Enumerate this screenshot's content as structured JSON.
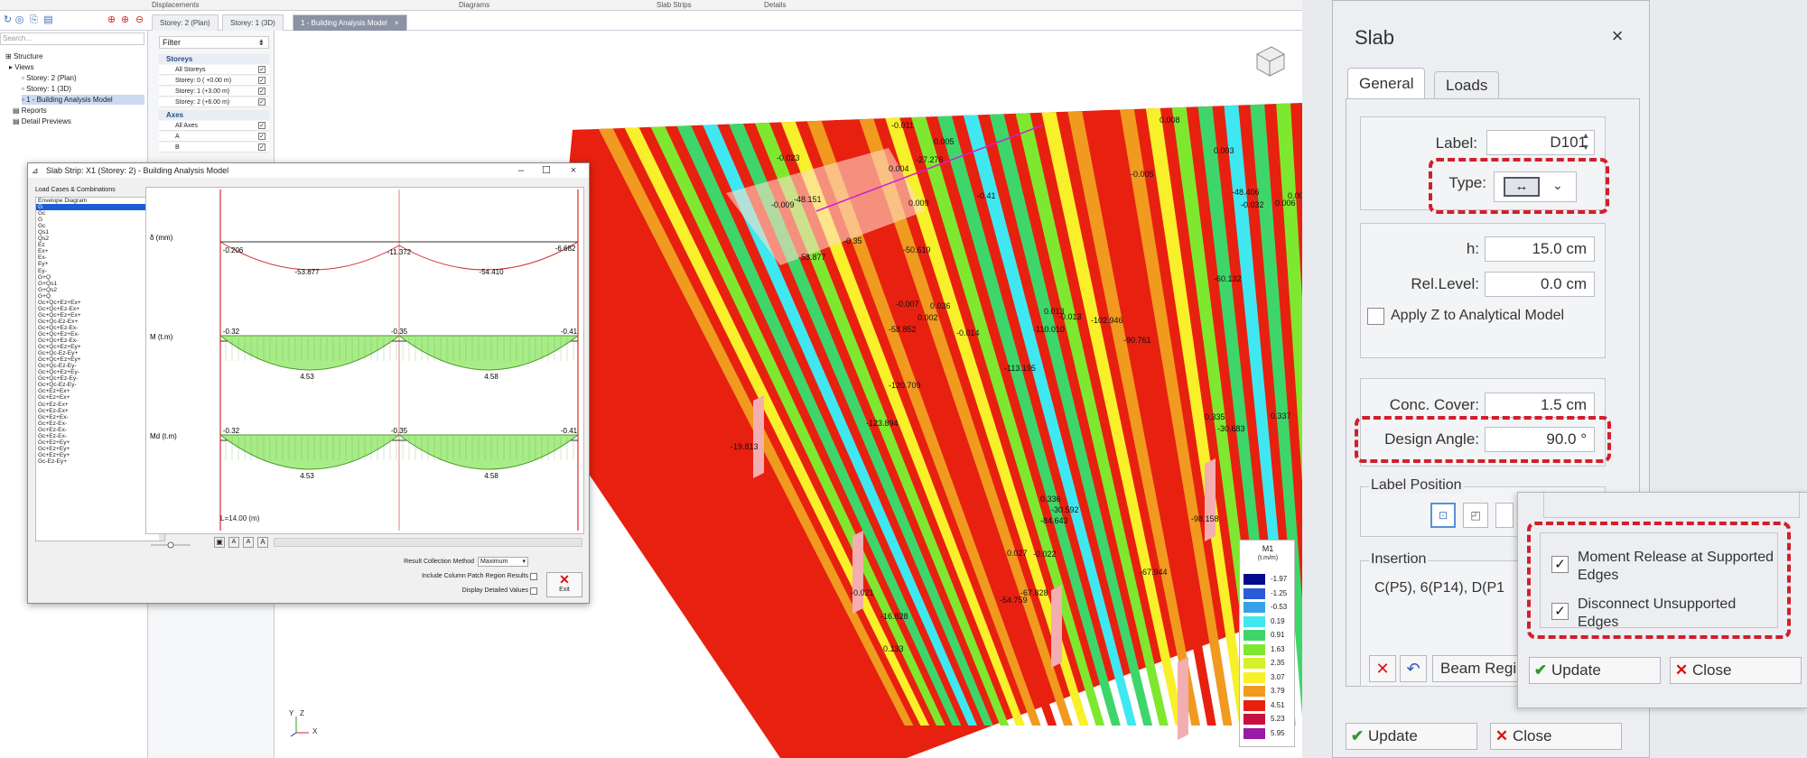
{
  "menubar": {
    "items": [
      "Displacements",
      "Diagrams",
      "Slab Strips",
      "Details"
    ]
  },
  "toolbar": {
    "icons": [
      "refresh-icon",
      "globe-icon",
      "link-icon",
      "print-icon",
      "zoom-fit-icon",
      "zoom-in-icon",
      "zoom-out-icon"
    ]
  },
  "tabs": [
    {
      "label": "Storey: 2 (Plan)"
    },
    {
      "label": "Storey: 1 (3D)"
    },
    {
      "label": "1 - Building Analysis Model",
      "active": true
    }
  ],
  "tab_close": "×",
  "search": {
    "placeholder": "Search..."
  },
  "tree": [
    {
      "label": "Structure"
    },
    {
      "label": "Views"
    },
    {
      "label": "Storey: 2 (Plan)"
    },
    {
      "label": "Storey: 1 (3D)"
    },
    {
      "label": "1 - Building Analysis Model",
      "selected": true
    },
    {
      "label": "Reports"
    },
    {
      "label": "Detail Previews"
    }
  ],
  "filter": {
    "label": "Filter",
    "storeys_header": "Storeys",
    "storeys": [
      "All Storeys",
      "Storey: 0 ( +0.00 m)",
      "Storey: 1 (+3.00 m)",
      "Storey: 2 (+6.00 m)"
    ],
    "axes_header": "Axes",
    "axes": [
      "All Axes",
      "A",
      "B"
    ],
    "check": "✓"
  },
  "viewport": {
    "labels": [
      "-0.011",
      "0.005",
      "-0.023",
      "0.004",
      "-0.009",
      "0.009",
      "-48.151",
      "-27.276",
      "-0.35",
      "-50.619",
      "-0.41",
      "-53.877",
      "-0.007",
      "0.002",
      "0.036",
      "-58.852",
      "-0.014",
      "0.013",
      "-110.010",
      "-113.195",
      "-123.894",
      "-120.709",
      "-102.946",
      "-90.761",
      "-60.132",
      "-48.406",
      "-0.005",
      "0.008",
      "0.335",
      "-30.683",
      "-30.592",
      "-84.643",
      "-67.828",
      "-67.944",
      "-54.759",
      "-98.158",
      "-19.813",
      "0.133",
      "-16.828",
      "-0.021",
      "0.336",
      "0.027",
      "-0.022",
      "0.337",
      "-67.9",
      "0.003",
      "0.006",
      "-0.032",
      "0.003",
      "-0.013"
    ],
    "axis_labels": [
      "Y",
      "Z",
      "X"
    ]
  },
  "legend": {
    "title": "M1",
    "unit": "(t.m/m)",
    "levels": [
      "-1.97",
      "-1.25",
      "-0.53",
      "0.19",
      "0.91",
      "1.63",
      "2.35",
      "3.07",
      "3.79",
      "4.51",
      "5.23",
      "5.95"
    ],
    "colors": [
      "#050a8c",
      "#2a5bd8",
      "#38a0e8",
      "#3fe8f0",
      "#3ed66a",
      "#7ee830",
      "#d6f02a",
      "#f8f02a",
      "#f09a20",
      "#e82010",
      "#c81040",
      "#9a1aa8"
    ]
  },
  "strip_window": {
    "title": "Slab Strip: X1 (Storey: 2) - Building Analysis Model",
    "load_cases_label": "Load Cases & Combinations",
    "load_cases": [
      "Envelope Diagram",
      "G",
      "Gc",
      "G",
      "Gc",
      "Qs1",
      "Qs2",
      "Ez",
      "Ex+",
      "Ex-",
      "Ey+",
      "Ey-",
      "G+Q",
      "G+Qs1",
      "G+Qs2",
      "G+Q",
      "Gc+Qc+Ez+Ex+",
      "Gc+Qc+Ez-Ex+",
      "Gc+Qc+Ez+Ex+",
      "Gc+Qc-Ez-Ex+",
      "Gc+Qc+Ez-Ex-",
      "Gc+Qc+Ez+Ex-",
      "Gc+Qc+Ez-Ex-",
      "Gc+Qc+Ez+Ey+",
      "Gc+Qc-Ez-Ey+",
      "Gc+Qc+Ez+Ey+",
      "Gc+Qc-Ez-Ey-",
      "Gc+Qc+Ez+Ey-",
      "Gc+Qc+Ez-Ey-",
      "Gc+Qc-Ez-Ey-",
      "Gc+Ez+Ex+",
      "Gc+Ez+Ex+",
      "Gc+Ez-Ex+",
      "Gc+Ez-Ex+",
      "Gc+Ez+Ex-",
      "Gc+Ez-Ex-",
      "Gc+Ez-Ex-",
      "Gc+Ez-Ex-",
      "Gc+Ez+Ey+",
      "Gc+Ez+Ey+",
      "Gc+Ez+Ey+",
      "Gc-Ez-Ey+"
    ],
    "selected_index": 1,
    "diagrams": [
      {
        "label": "δ (mm)",
        "values": [
          "-0.206",
          "-11.372",
          "-6.682",
          "-53.877",
          "-54.410"
        ]
      },
      {
        "label": "M (t.m)",
        "values": [
          "-0.32",
          "-0.35",
          "-0.41",
          "4.53",
          "4.58"
        ]
      },
      {
        "label": "Md (t.m)",
        "values": [
          "-0.32",
          "-0.35",
          "-0.41",
          "4.53",
          "4.58"
        ]
      }
    ],
    "length": "L=14.00 (m)",
    "zoom_buttons": [
      "A",
      "A",
      "A"
    ],
    "result_method_label": "Result Collection Method",
    "result_method_value": "Maximum",
    "include_label": "Include Column Patch Region Results",
    "display_label": "Display Detailed Values",
    "exit": "Exit"
  },
  "slab_dialog": {
    "title": "Slab",
    "close": "×",
    "tabs": [
      "General",
      "Loads"
    ],
    "label_label": "Label:",
    "label_value": "D101",
    "type_label": "Type:",
    "h_label": "h:",
    "h_value": "15.0 cm",
    "rel_label": "Rel.Level:",
    "rel_value": "0.0 cm",
    "apply_z": "Apply Z to Analytical Model",
    "cover_label": "Conc. Cover:",
    "cover_value": "1.5 cm",
    "angle_label": "Design Angle:",
    "angle_value": "90.0 °",
    "label_position": "Label Position",
    "insertion": "Insertion",
    "insertion_value": "C(P5), 6(P14), D(P1",
    "beam_region": "Beam Regi",
    "update": "Update",
    "close_btn": "Close"
  },
  "popup": {
    "moment_release": "Moment Release at Supported Edges",
    "disconnect": "Disconnect Unsupported Edges",
    "update": "Update",
    "close": "Close"
  }
}
